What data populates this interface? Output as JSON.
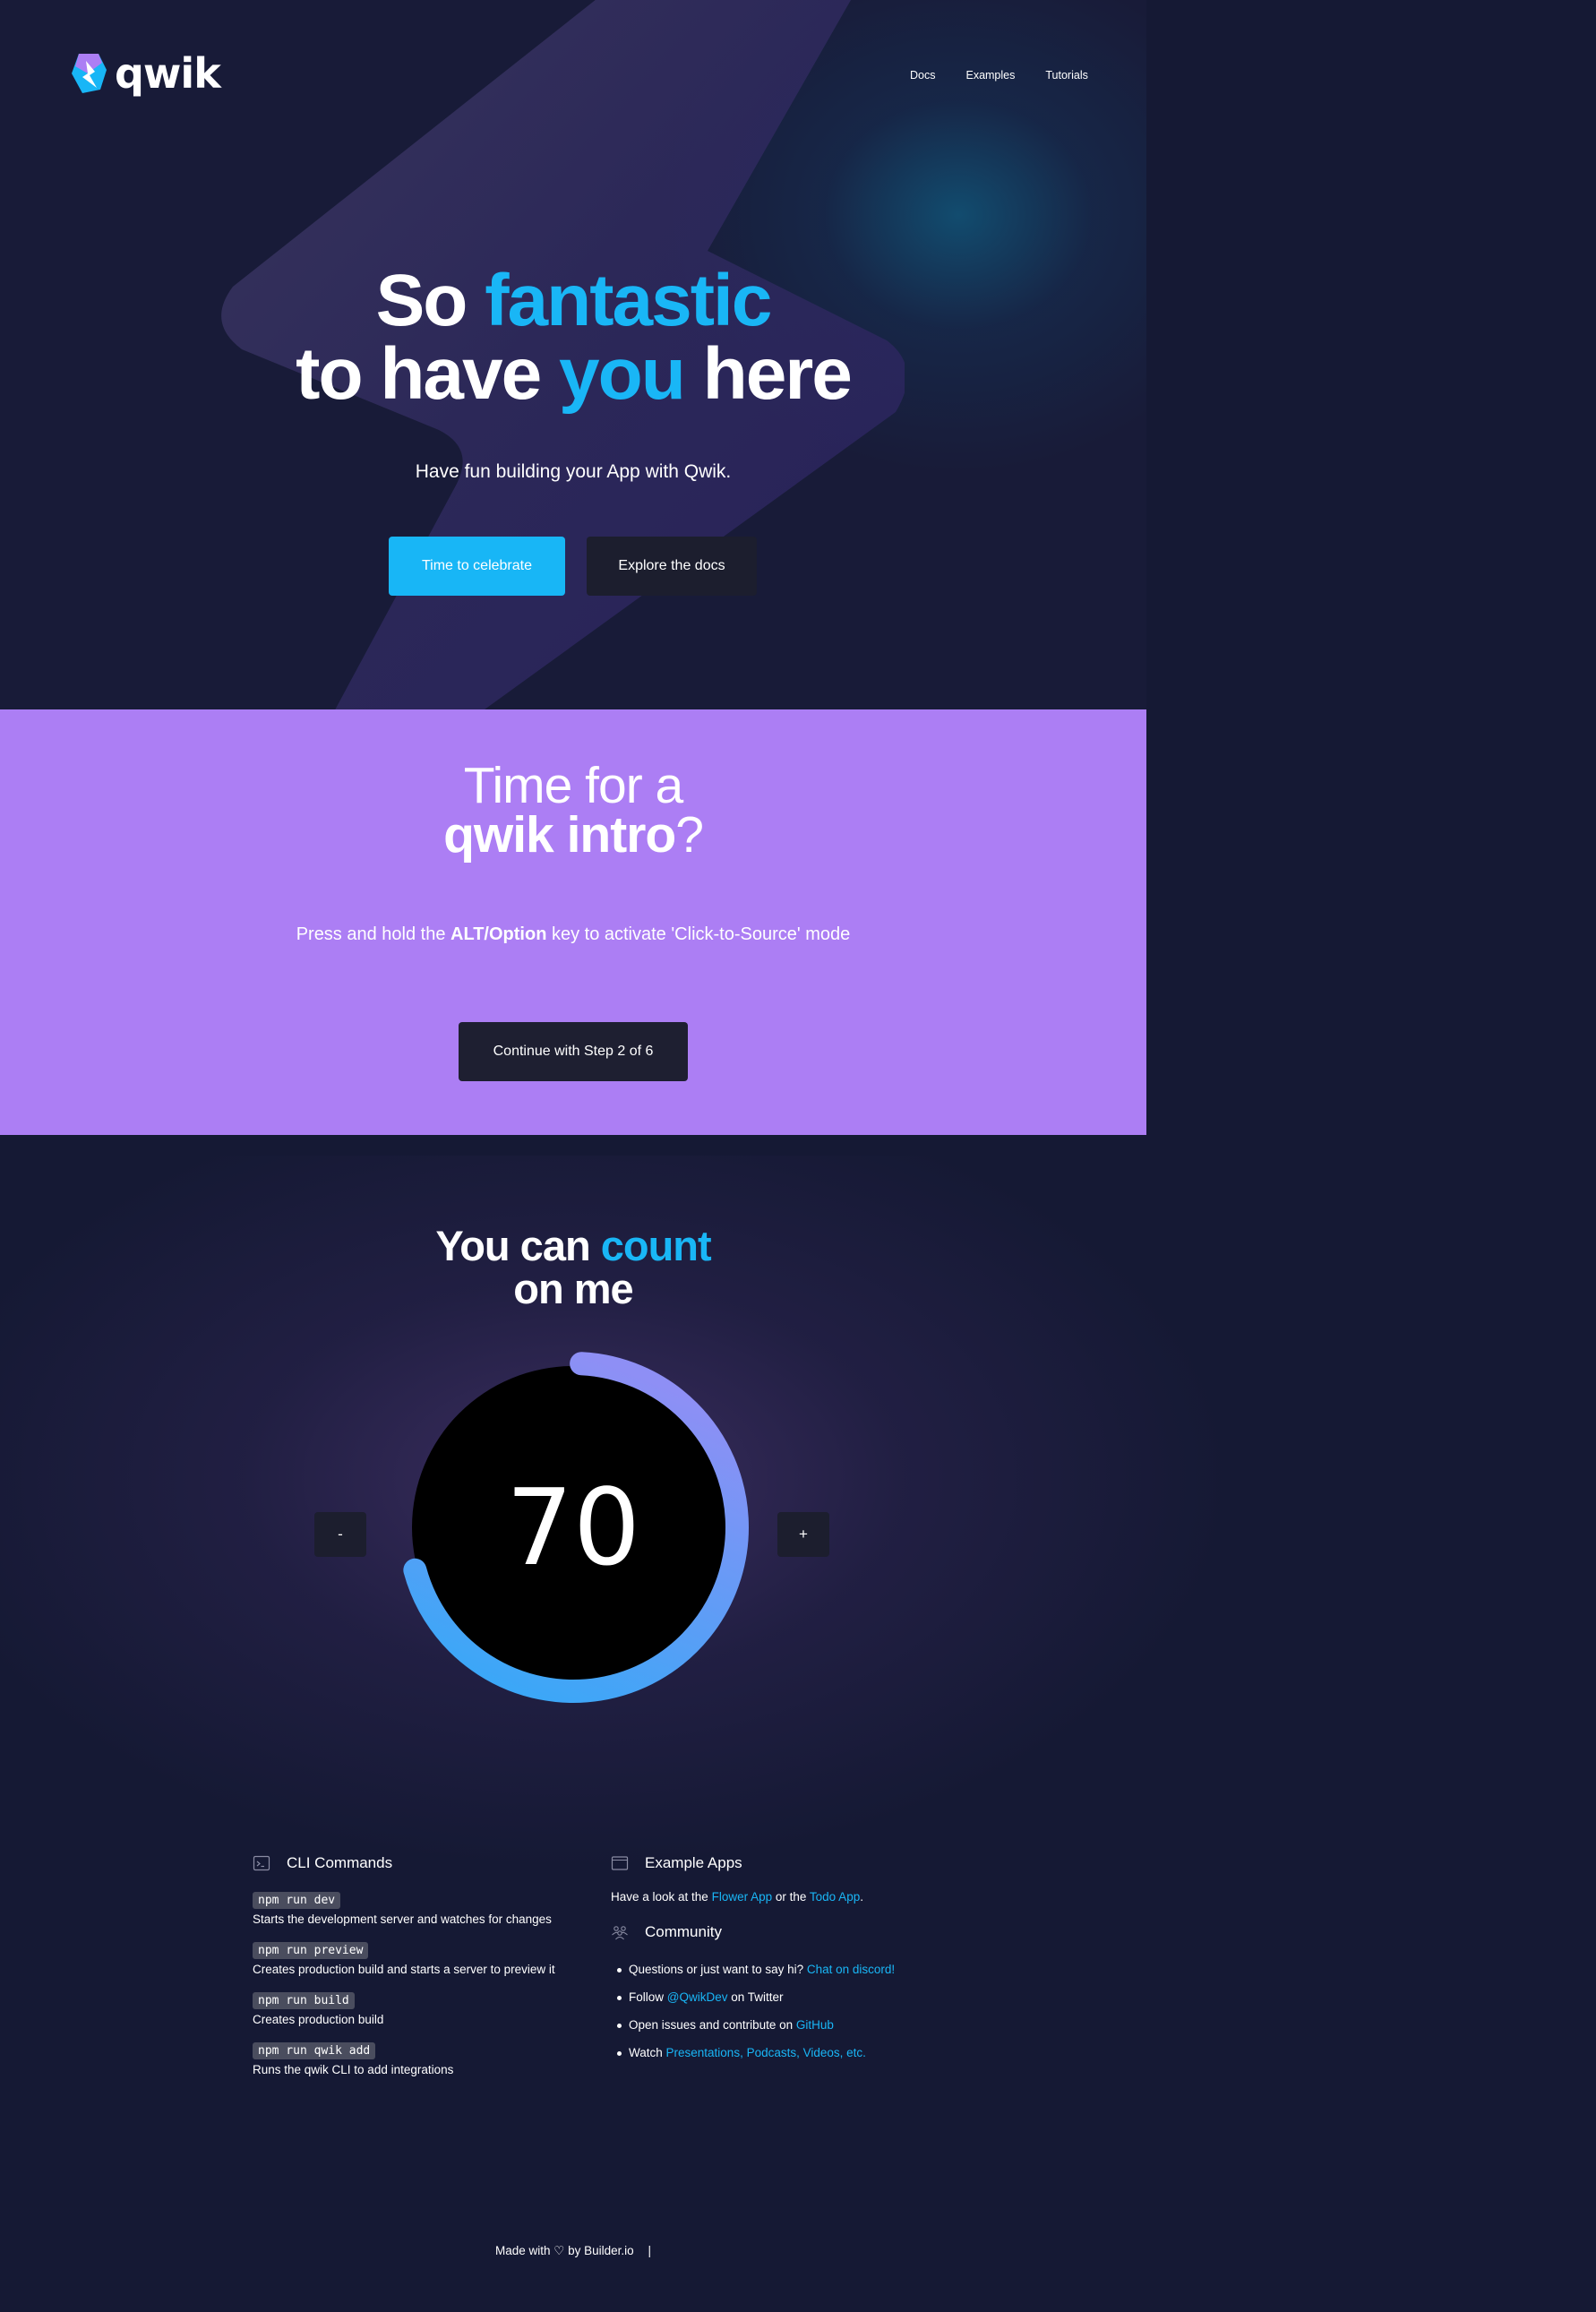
{
  "brand": {
    "name": "qwik"
  },
  "nav": {
    "items": [
      "Docs",
      "Examples",
      "Tutorials"
    ]
  },
  "hero": {
    "title_w1": "So",
    "title_w2": "fantastic",
    "title_w3": "to have",
    "title_w4": "you",
    "title_w5": "here",
    "subtitle": "Have fun building your App with Qwik.",
    "primary_button": "Time to celebrate",
    "secondary_button": "Explore the docs"
  },
  "intro": {
    "title_line1": "Time for a",
    "title_bold": "qwik intro",
    "title_q": "?",
    "text_before": "Press and hold the ",
    "text_bold": "ALT/Option",
    "text_after": " key to activate 'Click-to-Source' mode",
    "button": "Continue with Step 2 of 6"
  },
  "counter": {
    "title_w1": "You can",
    "title_w2": "count",
    "title_w3": "on me",
    "value": "70",
    "progress": 0.7,
    "minus_label": "-",
    "plus_label": "+",
    "colors": {
      "start": "#8e8ff5",
      "end": "#38a8f7"
    }
  },
  "cli": {
    "title": "CLI Commands",
    "commands": [
      {
        "cmd": "npm run dev",
        "desc": "Starts the development server and watches for changes"
      },
      {
        "cmd": "npm run preview",
        "desc": "Creates production build and starts a server to preview it"
      },
      {
        "cmd": "npm run build",
        "desc": "Creates production build"
      },
      {
        "cmd": "npm run qwik add",
        "desc": "Runs the qwik CLI to add integrations"
      }
    ]
  },
  "examples": {
    "title": "Example Apps",
    "text_before": "Have a look at the ",
    "link1": "Flower App",
    "text_mid": " or the ",
    "link2": "Todo App",
    "text_after": "."
  },
  "community": {
    "title": "Community",
    "item1_text": "Questions or just want to say hi? ",
    "item1_link": "Chat on discord!",
    "item2_before": "Follow ",
    "item2_link": "@QwikDev",
    "item2_after": " on Twitter",
    "item3_text": "Open issues and contribute on ",
    "item3_link": "GitHub",
    "item4_text": "Watch ",
    "item4_link": "Presentations, Podcasts, Videos, etc."
  },
  "footer": {
    "text": "Made with ♡ by Builder.io",
    "separator": "|"
  },
  "theme": {
    "accent": "#18b6f6",
    "intro_bg": "#ac7ef4",
    "dark_button": "#1c1e2e",
    "page_bg": "#151934"
  }
}
